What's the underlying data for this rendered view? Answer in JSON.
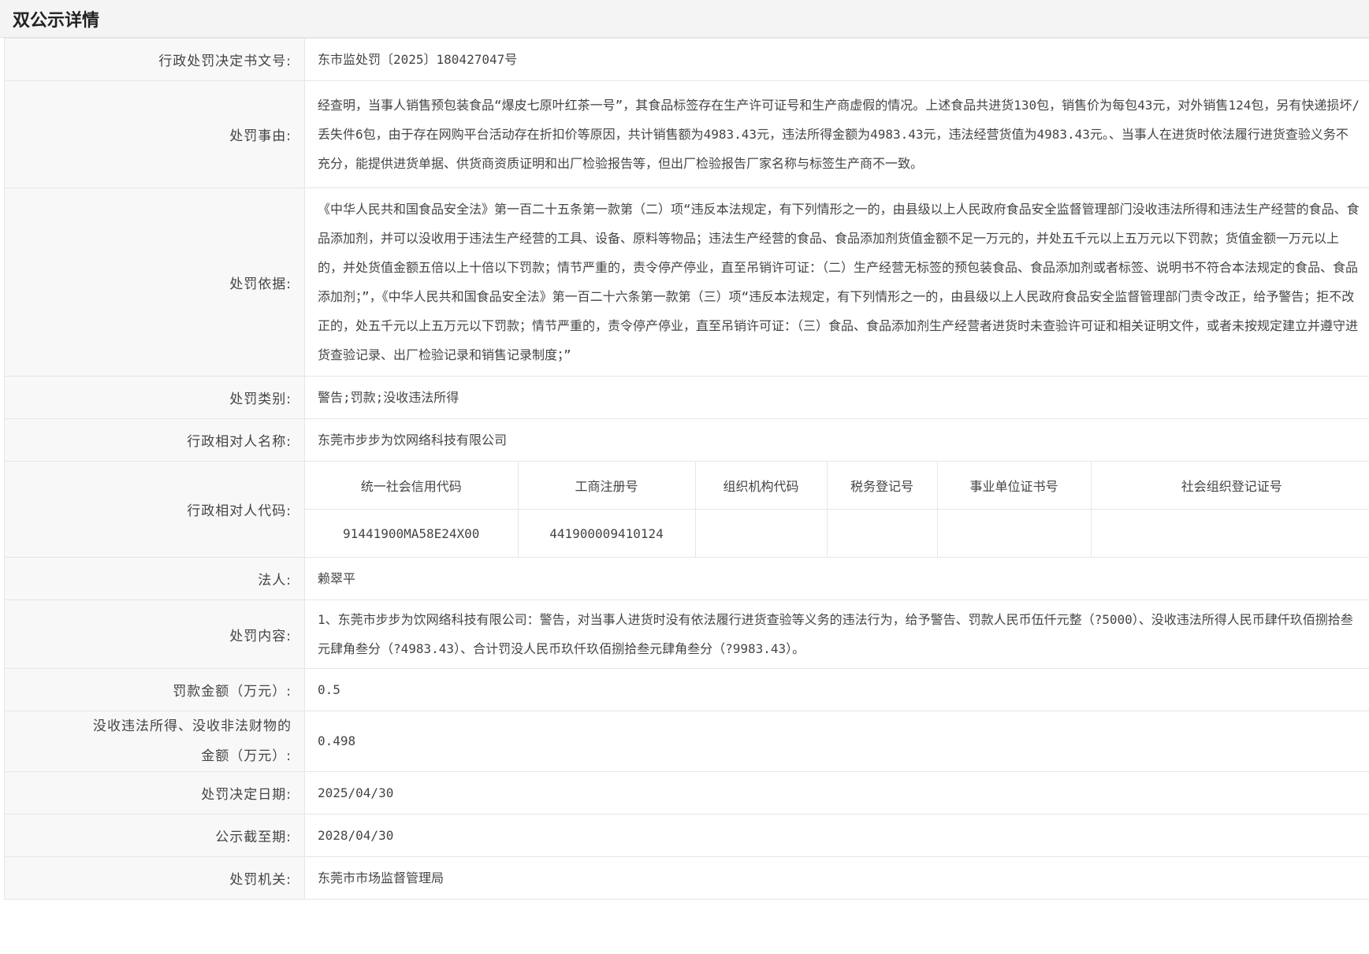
{
  "page_title": "双公示详情",
  "rows": {
    "doc_no": {
      "label": "行政处罚决定书文号:",
      "value": "东市监处罚〔2025〕180427047号"
    },
    "reason": {
      "label": "处罚事由:",
      "value": "经查明，当事人销售预包装食品“爆皮七原叶红茶一号”，其食品标签存在生产许可证号和生产商虚假的情况。上述食品共进货130包，销售价为每包43元，对外销售124包，另有快递损坏/丢失件6包，由于存在网购平台活动存在折扣价等原因，共计销售额为4983.43元，违法所得金额为4983.43元，违法经营货值为4983.43元。、当事人在进货时依法履行进货查验义务不充分，能提供进货单据、供货商资质证明和出厂检验报告等，但出厂检验报告厂家名称与标签生产商不一致。"
    },
    "basis": {
      "label": "处罚依据:",
      "value": "《中华人民共和国食品安全法》第一百二十五条第一款第（二）项“违反本法规定，有下列情形之一的，由县级以上人民政府食品安全监督管理部门没收违法所得和违法生产经营的食品、食品添加剂，并可以没收用于违法生产经营的工具、设备、原料等物品；违法生产经营的食品、食品添加剂货值金额不足一万元的，并处五千元以上五万元以下罚款；货值金额一万元以上的，并处货值金额五倍以上十倍以下罚款；情节严重的，责令停产停业，直至吊销许可证：（二）生产经营无标签的预包装食品、食品添加剂或者标签、说明书不符合本法规定的食品、食品添加剂；”，《中华人民共和国食品安全法》第一百二十六条第一款第（三）项“违反本法规定，有下列情形之一的，由县级以上人民政府食品安全监督管理部门责令改正，给予警告；拒不改正的，处五千元以上五万元以下罚款；情节严重的，责令停产停业，直至吊销许可证：（三）食品、食品添加剂生产经营者进货时未查验许可证和相关证明文件，或者未按规定建立并遵守进货查验记录、出厂检验记录和销售记录制度；”"
    },
    "category": {
      "label": "处罚类别:",
      "value": "警告;罚款;没收违法所得"
    },
    "party_name": {
      "label": "行政相对人名称:",
      "value": "东莞市步步为饮网络科技有限公司"
    },
    "party_code": {
      "label": "行政相对人代码:",
      "headers": [
        "统一社会信用代码",
        "工商注册号",
        "组织机构代码",
        "税务登记号",
        "事业单位证书号",
        "社会组织登记证号"
      ],
      "values": [
        "91441900MA58E24X00",
        "441900009410124",
        "",
        "",
        "",
        ""
      ]
    },
    "legal_person": {
      "label": "法人:",
      "value": "赖翠平"
    },
    "content": {
      "label": "处罚内容:",
      "value": "1、东莞市步步为饮网络科技有限公司：警告，对当事人进货时没有依法履行进货查验等义务的违法行为，给予警告、罚款人民币伍仟元整（?5000）、没收违法所得人民币肆仟玖佰捌拾叁元肆角叁分（?4983.43）、合计罚没人民币玖仟玖佰捌拾叁元肆角叁分（?9983.43）。"
    },
    "fine": {
      "label": "罚款金额（万元）:",
      "value": "0.5"
    },
    "confiscate": {
      "label_line1": "没收违法所得、没收非法财物的",
      "label_line2": "金额（万元）:",
      "value": "0.498"
    },
    "decision_date": {
      "label": "处罚决定日期:",
      "value": "2025/04/30"
    },
    "publicity_end": {
      "label": "公示截至期:",
      "value": "2028/04/30"
    },
    "authority": {
      "label": "处罚机关:",
      "value": "东莞市市场监督管理局"
    }
  }
}
